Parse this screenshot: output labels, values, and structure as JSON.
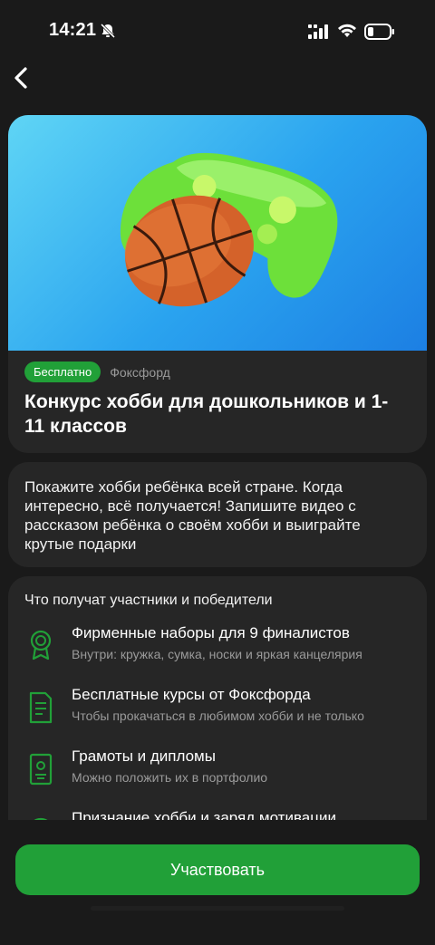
{
  "status_bar": {
    "time": "14:21"
  },
  "hero_card": {
    "badge": "Бесплатно",
    "provider": "Фоксфорд",
    "title": "Конкурс хобби для дошкольников и 1-11 классов"
  },
  "description": "Покажите хобби ребёнка всей стране. Когда интересно, всё получается! Запишите видео с рассказом ребёнка о своём хобби и выиграйте крутые подарки",
  "benefits": {
    "title": "Что получат участники и победители",
    "items": [
      {
        "title": "Фирменные наборы для 9 финалистов",
        "subtitle": "Внутри: кружка, сумка, носки и яркая канцелярия",
        "icon": "medal-icon"
      },
      {
        "title": "Бесплатные курсы от Фоксфорда",
        "subtitle": "Чтобы прокачаться в любимом хобби и не только",
        "icon": "document-icon"
      },
      {
        "title": "Грамоты и дипломы",
        "subtitle": "Можно положить их в портфолио",
        "icon": "certificate-icon"
      },
      {
        "title": "Признание хобби и заряд мотивации",
        "subtitle": "",
        "icon": "circle-icon"
      }
    ]
  },
  "cta": {
    "label": "Участвовать"
  },
  "colors": {
    "accent": "#21a038",
    "background": "#1a1a1a",
    "card": "#262626"
  }
}
